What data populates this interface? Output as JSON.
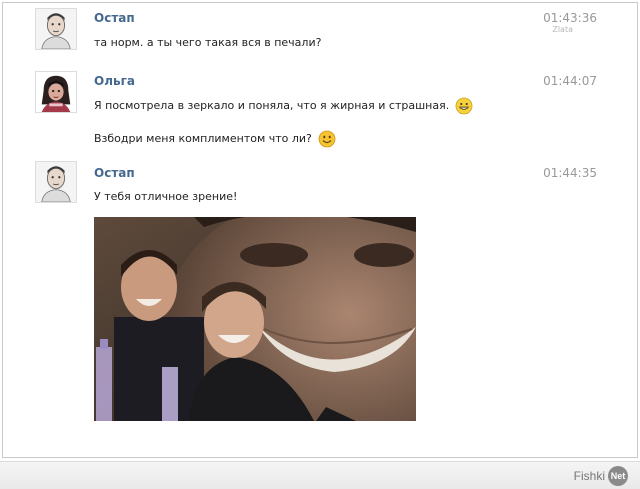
{
  "messages": [
    {
      "author": "Остап",
      "time": "01:43:36",
      "sub": "Zlata",
      "lines": [
        "та норм. а ты чего такая вся в печали?"
      ]
    },
    {
      "author": "Ольга",
      "time": "01:44:07",
      "lines": [
        "Я посмотрела в зеркало и поняла, что я жирная и страшная.",
        "Взбодри меня комплиментом что ли?"
      ],
      "emojis": [
        "grin-emoji",
        "smile-emoji"
      ]
    },
    {
      "author": "Остап",
      "time": "01:44:35",
      "lines": [
        "У тебя отличное зрение!"
      ],
      "attachment": "laughing-men-photo"
    }
  ],
  "watermark": {
    "brand": "Fishki",
    "badge": "Net"
  }
}
